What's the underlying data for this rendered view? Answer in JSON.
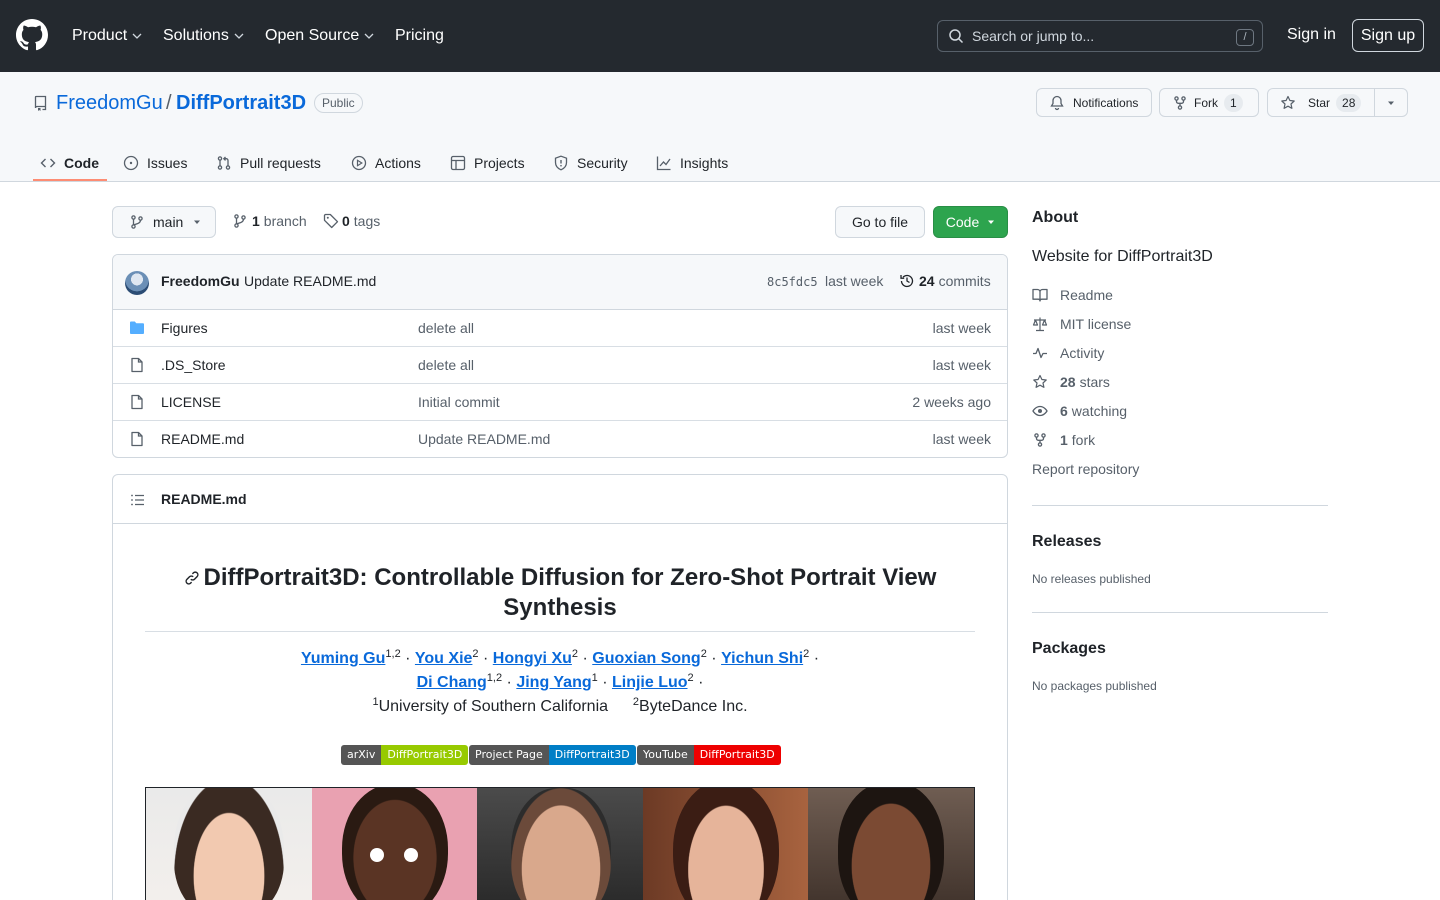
{
  "header": {
    "nav": [
      "Product",
      "Solutions",
      "Open Source",
      "Pricing"
    ],
    "search_placeholder": "Search or jump to...",
    "search_key": "/",
    "sign_in": "Sign in",
    "sign_up": "Sign up"
  },
  "repo": {
    "owner": "FreedomGu",
    "separator": "/",
    "name": "DiffPortrait3D",
    "visibility": "Public",
    "notifications_label": "Notifications",
    "fork_label": "Fork",
    "fork_count": "1",
    "star_label": "Star",
    "star_count": "28"
  },
  "tabs": [
    "Code",
    "Issues",
    "Pull requests",
    "Actions",
    "Projects",
    "Security",
    "Insights"
  ],
  "toolbar": {
    "branch": "main",
    "branches_count": "1",
    "branches_label": "branch",
    "tags_count": "0",
    "tags_label": "tags",
    "go_to_file": "Go to file",
    "code": "Code"
  },
  "commit": {
    "author": "FreedomGu",
    "message": "Update README.md",
    "sha": "8c5fdc5",
    "age": "last week",
    "commits_count": "24",
    "commits_label": "commits"
  },
  "files": [
    {
      "name": "Figures",
      "type": "dir",
      "message": "delete all",
      "age": "last week"
    },
    {
      "name": ".DS_Store",
      "type": "file",
      "message": "delete all",
      "age": "last week"
    },
    {
      "name": "LICENSE",
      "type": "file",
      "message": "Initial commit",
      "age": "2 weeks ago"
    },
    {
      "name": "README.md",
      "type": "file",
      "message": "Update README.md",
      "age": "last week"
    }
  ],
  "readme": {
    "filename": "README.md",
    "title": "DiffPortrait3D: Controllable Diffusion for Zero-Shot Portrait View Synthesis",
    "authors": [
      {
        "name": "Yuming Gu",
        "sup": "1,2"
      },
      {
        "name": "You Xie",
        "sup": "2"
      },
      {
        "name": "Hongyi Xu",
        "sup": "2"
      },
      {
        "name": "Guoxian Song",
        "sup": "2"
      },
      {
        "name": "Yichun Shi",
        "sup": "2"
      },
      {
        "name": "Di Chang",
        "sup": "1,2"
      },
      {
        "name": "Jing Yang",
        "sup": "1"
      },
      {
        "name": "Linjie Luo",
        "sup": "2"
      }
    ],
    "affiliation_1_sup": "1",
    "affiliation_1": "University of Southern California",
    "affiliation_2_sup": "2",
    "affiliation_2": "ByteDance Inc.",
    "separator": "·",
    "badges": [
      {
        "left": "arXiv",
        "right": "DiffPortrait3D",
        "color": "#97ca00"
      },
      {
        "left": "Project Page",
        "right": "DiffPortrait3D",
        "color": "#007ec6"
      },
      {
        "left": "YouTube",
        "right": "DiffPortrait3D",
        "color": "#e05d44"
      }
    ]
  },
  "about": {
    "heading": "About",
    "description": "Website for DiffPortrait3D",
    "readme": "Readme",
    "license": "MIT license",
    "activity": "Activity",
    "stars_count": "28",
    "stars_label": "stars",
    "watching_count": "6",
    "watching_label": "watching",
    "forks_count": "1",
    "forks_label": "fork",
    "report": "Report repository",
    "releases_heading": "Releases",
    "releases_text": "No releases published",
    "packages_heading": "Packages",
    "packages_text": "No packages published"
  },
  "colors": {
    "header_bg": "#24292f",
    "link": "#0969da",
    "primary_button": "#2da44e",
    "tab_underline": "#fd8c73"
  }
}
